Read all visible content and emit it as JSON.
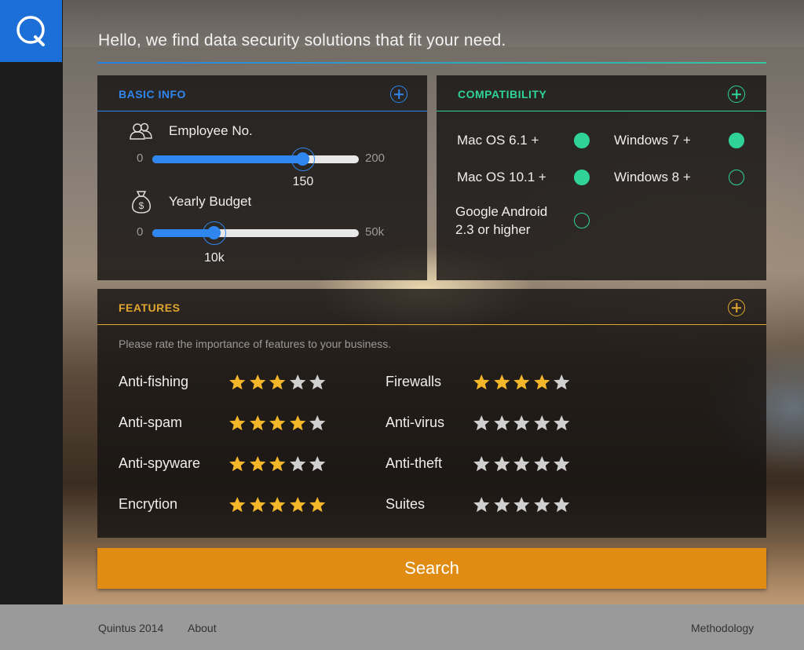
{
  "brand": {
    "logo_letter": "Q",
    "accent": "#1d6fd8"
  },
  "headline": "Hello, we find data security solutions that fit your need.",
  "basic_info": {
    "title": "BASIC INFO",
    "color": "#2f86ee",
    "employee": {
      "label": "Employee No.",
      "min": "0",
      "max": "200",
      "value": "150",
      "fraction": 0.73,
      "icon": "people-icon"
    },
    "budget": {
      "label": "Yearly Budget",
      "min": "0",
      "max": "50k",
      "value": "10k",
      "fraction": 0.3,
      "icon": "money-bag-icon"
    }
  },
  "compatibility": {
    "title": "COMPATIBILITY",
    "color": "#2fd39a",
    "items": [
      {
        "label": "Mac OS 6.1 +",
        "checked": true
      },
      {
        "label": "Windows 7 +",
        "checked": true
      },
      {
        "label": "Mac OS 10.1 +",
        "checked": true
      },
      {
        "label": "Windows 8 +",
        "checked": false
      },
      {
        "label": "Google Android 2.3 or higher",
        "line1": "Google Android",
        "line2": "2.3 or higher",
        "checked": false
      }
    ]
  },
  "features": {
    "title": "FEATURES",
    "color": "#e0a52e",
    "hint": "Please rate the importance of features to your business.",
    "star_on_color": "#f5b72a",
    "star_off_color": "#d0d0d0",
    "items": [
      {
        "label": "Anti-fishing",
        "rating": 3
      },
      {
        "label": "Firewalls",
        "rating": 4
      },
      {
        "label": "Anti-spam",
        "rating": 4
      },
      {
        "label": "Anti-virus",
        "rating": 0
      },
      {
        "label": "Anti-spyware",
        "rating": 3
      },
      {
        "label": "Anti-theft",
        "rating": 0
      },
      {
        "label": "Encrytion",
        "rating": 5
      },
      {
        "label": "Suites",
        "rating": 0
      }
    ]
  },
  "search_label": "Search",
  "footer": {
    "copyright": "Quintus 2014",
    "about": "About",
    "methodology": "Methodology"
  }
}
